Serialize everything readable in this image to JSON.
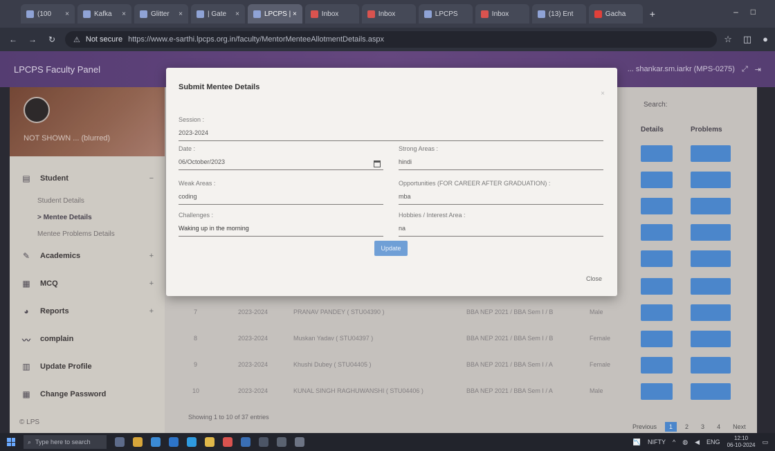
{
  "browser": {
    "tabs": [
      {
        "label": "(100"
      },
      {
        "label": "Kafka"
      },
      {
        "label": "Glitter"
      },
      {
        "label": "| Gate"
      },
      {
        "label": "LPCPS | ×",
        "active": true
      },
      {
        "label": "Inbox"
      },
      {
        "label": "Inbox"
      },
      {
        "label": "LPCPS"
      },
      {
        "label": "Inbox"
      },
      {
        "label": "(13) Ent"
      },
      {
        "label": "Gacha"
      }
    ],
    "not_secure": "Not secure",
    "url": "https://www.e-sarthi.lpcps.org.in/faculty/MentorMenteeAllotmentDetails.aspx"
  },
  "app": {
    "title": "LPCPS Faculty Panel",
    "user_label": "... shankar.sm.iarkr (MPS-0275)"
  },
  "sidebar": {
    "profile_name": "NOT SHOWN ... (blurred)",
    "menu": [
      {
        "label": "Student",
        "icon": "student-icon",
        "toggle": "−"
      },
      {
        "label": "Academics",
        "icon": "academics-icon",
        "toggle": "+"
      },
      {
        "label": "MCQ",
        "icon": "mcq-icon",
        "toggle": "+"
      },
      {
        "label": "Reports",
        "icon": "reports-icon",
        "toggle": "+"
      },
      {
        "label": "complain",
        "icon": "complain-icon",
        "toggle": ""
      },
      {
        "label": "Update Profile",
        "icon": "profile-icon",
        "toggle": ""
      },
      {
        "label": "Change Password",
        "icon": "password-icon",
        "toggle": ""
      }
    ],
    "submenu": [
      "Student Details",
      "> Mentee Details",
      "Mentee Problems Details"
    ],
    "footer": "© LPS"
  },
  "main": {
    "search_label": "Search:",
    "headers": {
      "details": "Details",
      "problems": "Problems"
    },
    "rows": [
      {
        "no": "7",
        "session": "2023-2024",
        "name": "PRANAV PANDEY ( STU04390 )",
        "course": "BBA NEP 2021 / BBA Sem I / B",
        "gender": "Male"
      },
      {
        "no": "8",
        "session": "2023-2024",
        "name": "Muskan Yadav ( STU04397 )",
        "course": "BBA NEP 2021 / BBA Sem I / B",
        "gender": "Female"
      },
      {
        "no": "9",
        "session": "2023-2024",
        "name": "Khushi Dubey ( STU04405 )",
        "course": "BBA NEP 2021 / BBA Sem I / A",
        "gender": "Female"
      },
      {
        "no": "10",
        "session": "2023-2024",
        "name": "KUNAL SINGH RAGHUWANSHI ( STU04406 )",
        "course": "BBA NEP 2021 / BBA Sem I / A",
        "gender": "Male"
      }
    ],
    "showing": "Showing 1 to 10 of 37 entries",
    "pager": [
      "Previous",
      "1",
      "2",
      "3",
      "4",
      "Next"
    ]
  },
  "modal": {
    "title": "Submit Mentee Details",
    "session_label": "Session :",
    "session_value": "2023-2024",
    "date_label": "Date :",
    "date_value": "06/October/2023",
    "strong_label": "Strong Areas :",
    "strong_value": "hindi",
    "weak_label": "Weak Areas :",
    "weak_value": "coding",
    "opp_label": "Opportunities (FOR CAREER AFTER GRADUATION) :",
    "opp_value": "mba",
    "challenges_label": "Challenges :",
    "challenges_value": "Waking up in the morning",
    "hobbies_label": "Hobbies / Interest Area :",
    "hobbies_value": "na",
    "update_label": "Update",
    "close_label": "Close",
    "close_x": "×"
  },
  "taskbar": {
    "search_placeholder": "Type here to search",
    "nifty": "NIFTY",
    "lang": "ENG",
    "time": "12:10",
    "date": "06-10-2024"
  }
}
